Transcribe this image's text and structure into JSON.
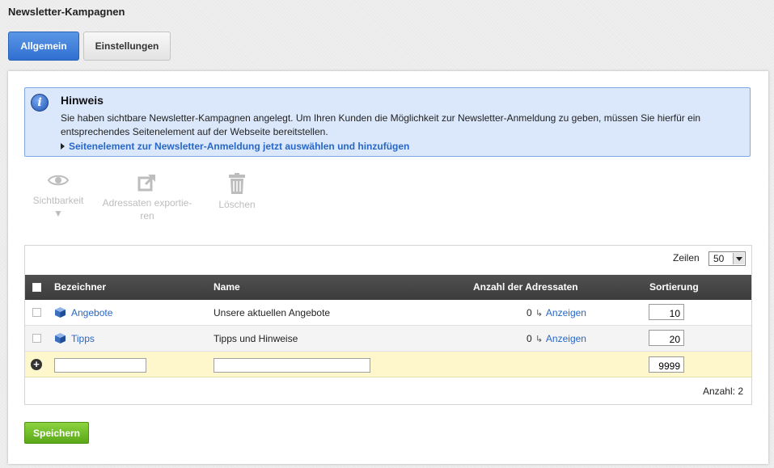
{
  "page": {
    "title": "Newsletter-Kampagnen"
  },
  "tabs": [
    {
      "label": "Allgemein",
      "active": true
    },
    {
      "label": "Einstellungen",
      "active": false
    }
  ],
  "notice": {
    "icon": "info-icon",
    "title": "Hinweis",
    "text": "Sie haben sichtbare Newsletter-Kampagnen angelegt. Um Ihren Kunden die Möglichkeit zur Newsletter-Anmeldung zu geben, müssen Sie hierfür ein entsprechendes Seitenelement auf der Webseite bereitstellen.",
    "link": "Seitenelement zur Newsletter-Anmeldung jetzt auswählen und hinzufügen"
  },
  "actions": [
    {
      "label": "Sichtbarkeit",
      "icon": "eye-icon",
      "dropdown_marker": "▼"
    },
    {
      "label": "Adressaten exportie-ren",
      "icon": "export-icon"
    },
    {
      "label": "Löschen",
      "icon": "trash-icon"
    }
  ],
  "rows_control": {
    "label": "Zeilen",
    "value": "50"
  },
  "table": {
    "columns": [
      "Bezeichner",
      "Name",
      "Anzahl der Adressaten",
      "Sortierung"
    ],
    "rows": [
      {
        "id_label": "Angebote",
        "name": "Unsere aktuellen Angebote",
        "count": "0",
        "view_label": "Anzeigen",
        "sort": "10"
      },
      {
        "id_label": "Tipps",
        "name": "Tipps und Hinweise",
        "count": "0",
        "view_label": "Anzeigen",
        "sort": "20"
      }
    ],
    "new_row": {
      "id_value": "",
      "name_value": "",
      "sort_value": "9999"
    },
    "count_text": "Anzahl: 2"
  },
  "save_label": "Speichern",
  "colors": {
    "active_tab": "#2f6fd1",
    "notice_bg": "#dbe8fb",
    "link": "#2867c5",
    "header_bg": "#444444",
    "new_row_bg": "#fff7cc",
    "save_button": "#6cbb24"
  }
}
